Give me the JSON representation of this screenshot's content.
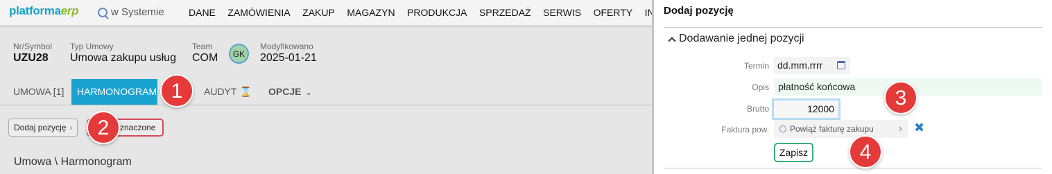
{
  "app": {
    "logo_part1": "platforma",
    "logo_part2": "erp",
    "search_label": "w Systemie",
    "nav": [
      "DANE",
      "ZAMÓWIENIA",
      "ZAKUP",
      "MAGAZYN",
      "PRODUKCJA",
      "SPRZEDAŻ",
      "SERWIS",
      "OFERTY",
      "INTEGRA"
    ]
  },
  "record": {
    "symbol_label": "Nr/Symbol",
    "symbol_value": "UZU28",
    "type_label": "Typ Umowy",
    "type_value": "Umowa zakupu usług",
    "team_label": "Team",
    "team_value": "COM",
    "avatar_initials": "GK",
    "modified_label": "Modyfikowano",
    "modified_value": "2025-01-21"
  },
  "tabs": {
    "contract": "UMOWA [1]",
    "schedule": "HARMONOGRAM",
    "audit": "AUDYT",
    "options": "OPCJE"
  },
  "actions": {
    "add_position": "Dodaj pozycję",
    "marked_suffix": "znaczone"
  },
  "breadcrumb": "Umowa \\ Harmonogram",
  "badges": [
    "1",
    "2",
    "3",
    "4"
  ],
  "panel": {
    "title": "Dodaj pozycję",
    "section": "Dodawanie jednej pozycji",
    "fields": {
      "term_label": "Termin",
      "term_placeholder": "dd.mm.rrrr",
      "desc_label": "Opis",
      "desc_value": "płatność końcowa",
      "gross_label": "Brutto",
      "gross_value": "12000",
      "invoice_label": "Faktura pow.",
      "invoice_placeholder": "Powiąż fakturę zakupu"
    },
    "save_label": "Zapisz"
  },
  "colors": {
    "active_tab": "#1aa3d1",
    "badge": "#e53a3a",
    "save_border": "#3aad7a",
    "marked_border": "#d24a5a"
  }
}
